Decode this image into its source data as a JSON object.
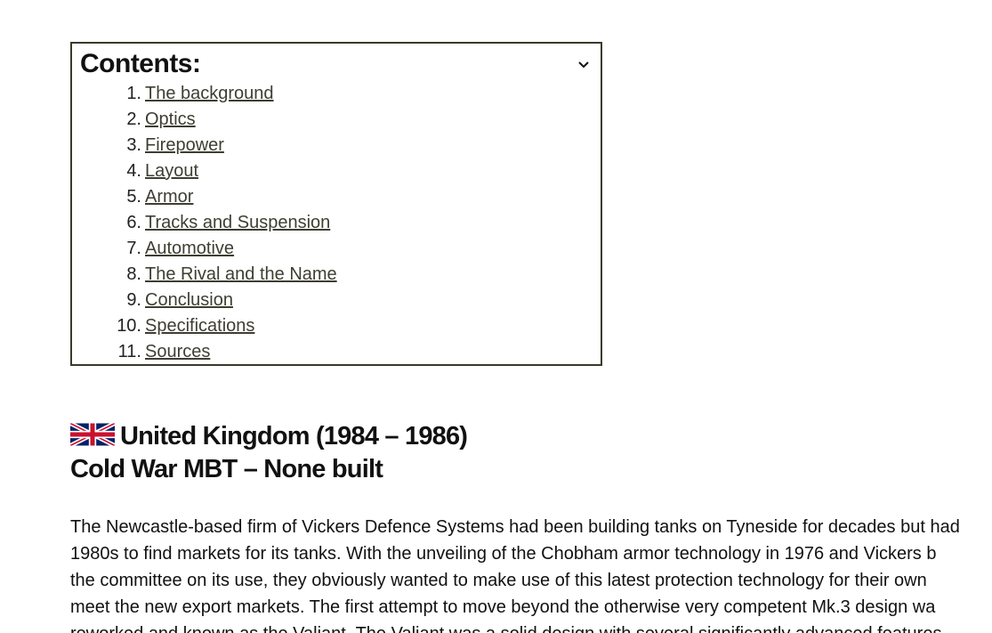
{
  "toc": {
    "title": "Contents:",
    "toggle_icon": "chevron-down-icon",
    "items": [
      {
        "num": "1.",
        "label": "The background"
      },
      {
        "num": "2.",
        "label": "Optics"
      },
      {
        "num": "3.",
        "label": "Firepower"
      },
      {
        "num": "4.",
        "label": "Layout"
      },
      {
        "num": "5.",
        "label": "Armor"
      },
      {
        "num": "6.",
        "label": "Tracks and Suspension"
      },
      {
        "num": "7.",
        "label": "Automotive"
      },
      {
        "num": "8.",
        "label": "The Rival and the Name"
      },
      {
        "num": "9.",
        "label": "Conclusion"
      },
      {
        "num": "10.",
        "label": "Specifications"
      },
      {
        "num": "11.",
        "label": "Sources"
      }
    ]
  },
  "article": {
    "flag_icon": "uk-flag-icon",
    "heading_line1": "United Kingdom (1984 – 1986)",
    "heading_line2": "Cold War MBT  – None built",
    "body_lines": [
      "The Newcastle-based firm of Vickers Defence Systems had been building tanks on Tyneside for decades but had",
      "1980s to find markets for its tanks. With the unveiling of the Chobham armor technology in 1976 and Vickers b",
      "the committee on its use, they obviously wanted to make use of this latest protection technology for their own",
      "meet the new export markets. The first attempt to move beyond the otherwise very competent Mk.3 design wa",
      "reworked and known as the Valiant. The Valiant was a solid design with several significantly advanced features"
    ]
  },
  "colors": {
    "link": "#3e3e32",
    "border": "#3a3a2a",
    "text": "#111111"
  }
}
